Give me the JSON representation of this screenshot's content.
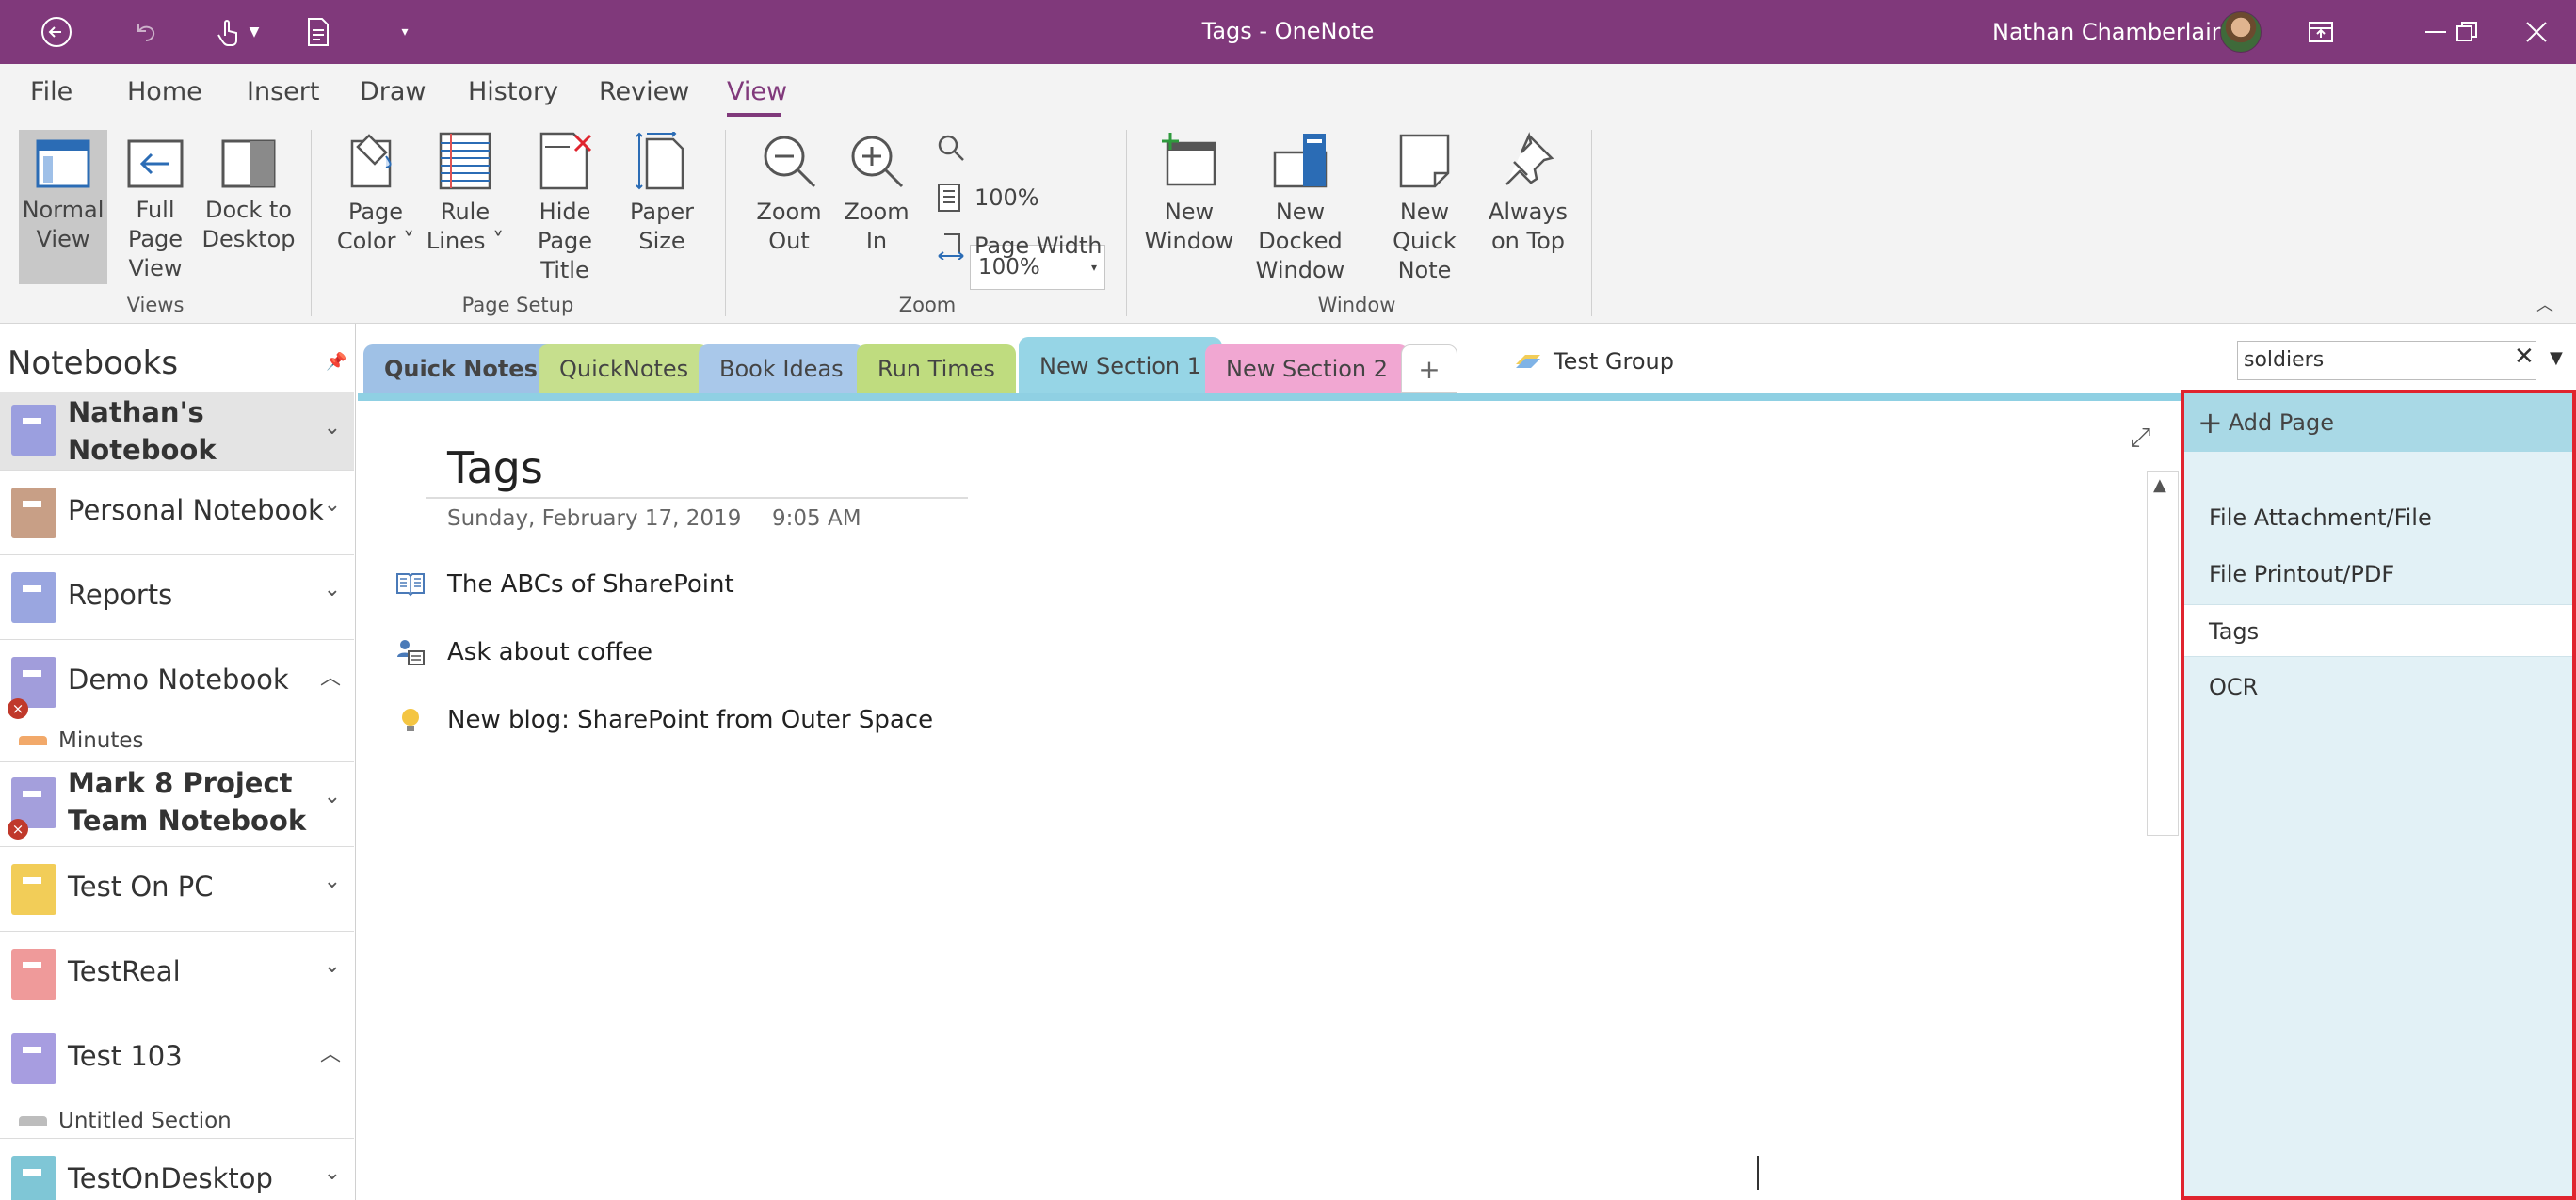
{
  "window": {
    "title": "Tags  -  OneNote",
    "user": "Nathan Chamberlain"
  },
  "quick_access": [
    "back-icon",
    "undo-icon",
    "touch-mode-icon",
    "print-preview-icon",
    "customize-dropdown-icon"
  ],
  "menu_tabs": [
    {
      "label": "File"
    },
    {
      "label": "Home"
    },
    {
      "label": "Insert"
    },
    {
      "label": "Draw"
    },
    {
      "label": "History"
    },
    {
      "label": "Review"
    },
    {
      "label": "View",
      "active": true
    }
  ],
  "ribbon": {
    "views": {
      "group": "Views",
      "normal": [
        "Normal",
        "View"
      ],
      "fullpage": [
        "Full Page",
        "View"
      ],
      "dock": [
        "Dock to",
        "Desktop"
      ]
    },
    "page_setup": {
      "group": "Page Setup",
      "color": [
        "Page",
        "Color ˅"
      ],
      "rule": [
        "Rule",
        "Lines ˅"
      ],
      "hide": [
        "Hide",
        "Page Title"
      ],
      "paper": [
        "Paper",
        "Size"
      ]
    },
    "zoom": {
      "group": "Zoom",
      "out": [
        "Zoom",
        "Out"
      ],
      "in": [
        "Zoom",
        "In"
      ],
      "value": "100%",
      "hundred": "100%",
      "page_width": "Page Width"
    },
    "window": {
      "group": "Window",
      "new": [
        "New",
        "Window"
      ],
      "docked": [
        "New Docked",
        "Window"
      ],
      "quick": [
        "New Quick",
        "Note"
      ],
      "ontop": [
        "Always",
        "on Top"
      ]
    }
  },
  "notebooks": {
    "header": "Notebooks",
    "items": [
      {
        "name": "Nathan's Notebook",
        "color": "#9b9fdf",
        "bold": true,
        "expanded": false
      },
      {
        "name": "Personal Notebook",
        "color": "#c89f86",
        "expanded": false
      },
      {
        "name": "Reports",
        "color": "#9aa6e0",
        "expanded": false
      },
      {
        "name": "Demo Notebook",
        "color": "#a19ddb",
        "error": true,
        "expanded": true,
        "section": "Minutes"
      },
      {
        "name": "Mark 8 Project Team Notebook",
        "color": "#a49fdc",
        "bold": true,
        "error": true,
        "expanded": false
      },
      {
        "name": "Test On PC",
        "color": "#f2cd58",
        "expanded": false
      },
      {
        "name": "TestReal",
        "color": "#ef9a9a",
        "expanded": false
      },
      {
        "name": "Test 103",
        "color": "#a79de0",
        "expanded": true,
        "section": "Untitled Section"
      },
      {
        "name": "TestOnDesktop",
        "color": "#7fc6d6",
        "expanded": false
      }
    ]
  },
  "sections": [
    {
      "label": "Quick Notes",
      "color": "#9fc1e6",
      "bold": true
    },
    {
      "label": "QuickNotes",
      "color": "#c6df8d"
    },
    {
      "label": "Book Ideas",
      "color": "#a9c8ea"
    },
    {
      "label": "Run Times",
      "color": "#bfdc7f"
    },
    {
      "label": "New Section 1",
      "color": "#96d5e6",
      "active": true
    },
    {
      "label": "New Section 2",
      "color": "#f1a7d2"
    }
  ],
  "section_group": "Test Group",
  "search": {
    "value": "soldiers"
  },
  "page": {
    "title": "Tags",
    "date": "Sunday, February 17, 2019",
    "time": "9:05 AM",
    "notes": [
      {
        "text": "The ABCs of SharePoint",
        "icon": "book-tag-icon"
      },
      {
        "text": "Ask about coffee",
        "icon": "contact-tag-icon"
      },
      {
        "text": "New blog: SharePoint from Outer Space",
        "icon": "idea-tag-icon"
      }
    ]
  },
  "page_list": {
    "add_label": "Add Page",
    "pages": [
      {
        "label": "File Attachment/File"
      },
      {
        "label": "File Printout/PDF"
      },
      {
        "label": "Tags",
        "selected": true
      },
      {
        "label": "OCR"
      }
    ]
  },
  "colors": {
    "accent": "#80397b",
    "pane_border": "#e0242e",
    "section_line": "#8fd0e3"
  }
}
